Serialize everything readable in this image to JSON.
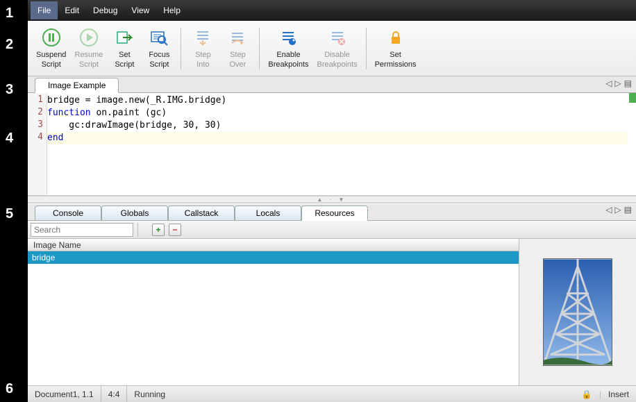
{
  "markers": {
    "m1": "1",
    "m2": "2",
    "m3": "3",
    "m4": "4",
    "m5": "5",
    "m6": "6"
  },
  "menubar": {
    "file": "File",
    "edit": "Edit",
    "debug": "Debug",
    "view": "View",
    "help": "Help"
  },
  "toolbar": {
    "suspend": "Suspend\nScript",
    "resume": "Resume\nScript",
    "set": "Set\nScript",
    "focus": "Focus\nScript",
    "stepinto": "Step\nInto",
    "stepover": "Step\nOver",
    "enablebp": "Enable\nBreakpoints",
    "disablebp": "Disable\nBreakpoints",
    "setperm": "Set\nPermissions"
  },
  "doc_tab": "Image Example",
  "code": {
    "l1_num": "1",
    "l1_a": "bridge = image.new(_R.IMG.bridge)",
    "l2_num": "2",
    "l2_kw": "function",
    "l2_rest": " on.paint (gc)",
    "l3_num": "3",
    "l3_a": "    gc:drawImage(bridge, 30, 30)",
    "l4_num": "4",
    "l4_kw": "end"
  },
  "pane_tabs": {
    "console": "Console",
    "globals": "Globals",
    "callstack": "Callstack",
    "locals": "Locals",
    "resources": "Resources"
  },
  "search": {
    "placeholder": "Search"
  },
  "resources": {
    "header": "Image Name",
    "row0": "bridge"
  },
  "status": {
    "doc": "Document1, 1.1",
    "pos": "4:4",
    "state": "Running",
    "mode": "Insert"
  }
}
